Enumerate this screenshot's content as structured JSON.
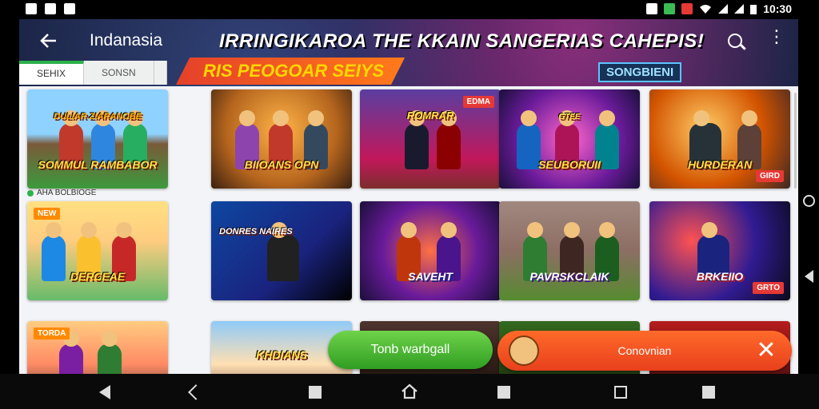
{
  "status_bar": {
    "time": "10:30",
    "left_icons": [
      "notification-icon",
      "image-icon",
      "image-icon"
    ],
    "right_icons": [
      "shield-icon",
      "app-icon",
      "alert-icon",
      "wifi-icon",
      "signal-icon",
      "signal-icon",
      "battery-icon"
    ]
  },
  "header": {
    "app_title": "Indanasia",
    "banner_title": "IRRINGIKAROA THE KKAIN SANGERIAS CAHEPIS!",
    "banner_subtitle": "RIS PEOGOAR SEIYS",
    "banner_badge": "SONGBIENI"
  },
  "tabs": [
    {
      "label": "SEHIX",
      "active": true
    },
    {
      "label": "SONSN",
      "active": false
    },
    {
      "label": "",
      "active": false
    }
  ],
  "section_label": "AHA BOLBIOGE",
  "cards": [
    {
      "title": "SOMMUL RAMBABOR",
      "badge": "",
      "top_title": "DULIAR ZIARANOBE"
    },
    {
      "title": "BIIOANS OPN",
      "badge": "",
      "top_title": ""
    },
    {
      "title": "",
      "badge": "EDMA",
      "top_title": "ROMRAR"
    },
    {
      "title": "SEUBORUII",
      "badge": "",
      "top_title": "GTEE"
    },
    {
      "title": "HURDERAN",
      "badge": "GIRD",
      "top_title": ""
    },
    {
      "title": "DERCEAE",
      "badge": "",
      "top_title": ""
    },
    {
      "title": "DONRES NAIRES",
      "badge": "",
      "top_title": ""
    },
    {
      "title": "SAVEHT",
      "badge": "",
      "top_title": ""
    },
    {
      "title": "PAVRSKCLAIK",
      "badge": "",
      "top_title": ""
    },
    {
      "title": "BRKEIIO",
      "badge": "GRTO",
      "top_title": ""
    },
    {
      "title": "",
      "badge": "TORDA",
      "top_title": ""
    },
    {
      "title": "KHDIANS",
      "badge": "",
      "top_title": ""
    }
  ],
  "float_green": {
    "label": "Tonb warbgall"
  },
  "float_orange": {
    "label": "Conovnian"
  },
  "colors": {
    "accent_green": "#2eb14a",
    "accent_orange": "#e8401c",
    "banner_yellow": "#ffd700"
  }
}
